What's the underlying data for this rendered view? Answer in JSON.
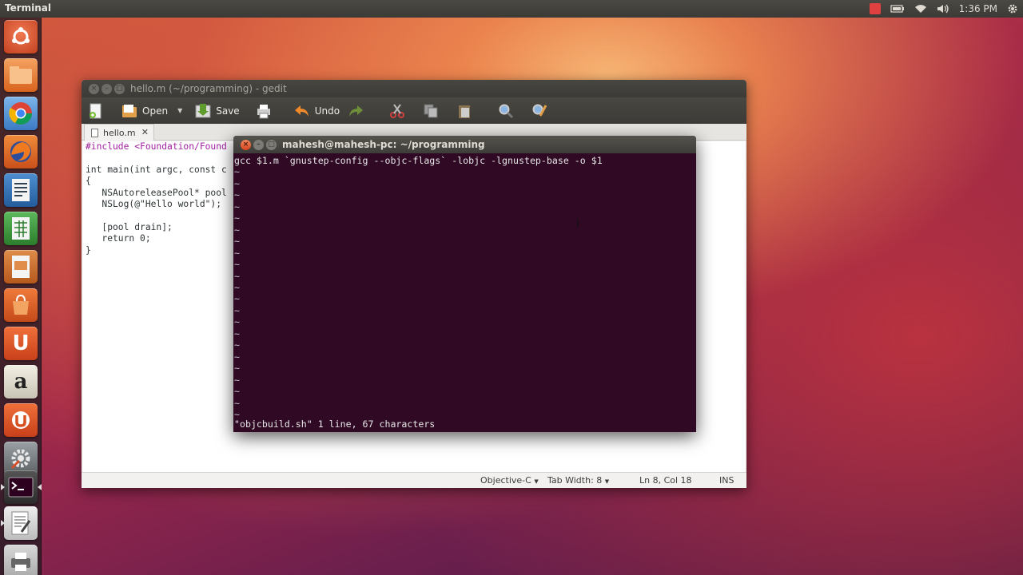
{
  "top_panel": {
    "title": "Terminal",
    "clock": "1:36 PM",
    "indicators": [
      "battery-icon",
      "wifi-icon",
      "volume-icon",
      "gear-icon"
    ]
  },
  "launcher": {
    "items": [
      {
        "name": "dash-icon",
        "color": "#d64e2b"
      },
      {
        "name": "files-icon",
        "color": "#e07b2b"
      },
      {
        "name": "chrome-icon",
        "color": "#4a90d9"
      },
      {
        "name": "firefox-icon",
        "color": "#e0671f"
      },
      {
        "name": "writer-icon",
        "color": "#2f6fb6"
      },
      {
        "name": "calc-icon",
        "color": "#3f9a3b"
      },
      {
        "name": "impress-icon",
        "color": "#c0611f"
      },
      {
        "name": "software-center-icon",
        "color": "#d9682a"
      },
      {
        "name": "ubuntu-one-icon",
        "color": "#e0582a"
      },
      {
        "name": "amazon-icon",
        "color": "#d8d4c6"
      },
      {
        "name": "ubuntu-one-music-icon",
        "color": "#e0582a"
      },
      {
        "name": "system-settings-icon",
        "color": "#8b8f92"
      },
      {
        "name": "terminal-icon",
        "color": "#3a3a3a"
      },
      {
        "name": "text-editor-icon",
        "color": "#cfcfcf"
      },
      {
        "name": "printer-icon",
        "color": "#bdbdbd"
      }
    ]
  },
  "gedit": {
    "title": "hello.m (~/programming) - gedit",
    "toolbar": {
      "open_label": "Open",
      "save_label": "Save",
      "undo_label": "Undo"
    },
    "tab_label": "hello.m",
    "code_lines": [
      "#include <Foundation/Found",
      "",
      "int main(int argc, const c",
      "{",
      "   NSAutoreleasePool* pool",
      "   NSLog(@\"Hello world\");",
      "",
      "   [pool drain];",
      "   return 0;",
      "}"
    ],
    "status": {
      "language": "Objective-C",
      "tab_width": "Tab Width: 8",
      "position": "Ln 8, Col 18",
      "mode": "INS"
    }
  },
  "terminal": {
    "title": "mahesh@mahesh-pc: ~/programming",
    "first_line": "gcc $1.m `gnustep-config --objc-flags` -lobjc -lgnustep-base -o $1",
    "tilde": "~",
    "status_line": "\"objcbuild.sh\" 1 line, 67 characters"
  }
}
